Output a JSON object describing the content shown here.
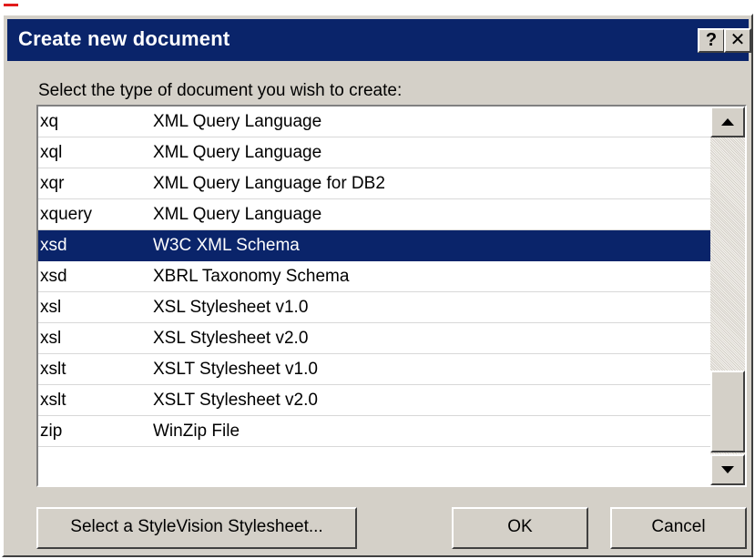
{
  "window": {
    "title": "Create new document",
    "help_label": "?",
    "close_label": "✕"
  },
  "prompt": "Select the type of document you wish to create:",
  "document_types": [
    {
      "ext": "xq",
      "description": "XML Query Language",
      "selected": false
    },
    {
      "ext": "xql",
      "description": "XML Query Language",
      "selected": false
    },
    {
      "ext": "xqr",
      "description": "XML Query Language for DB2",
      "selected": false
    },
    {
      "ext": "xquery",
      "description": "XML Query Language",
      "selected": false
    },
    {
      "ext": "xsd",
      "description": "W3C XML Schema",
      "selected": true
    },
    {
      "ext": "xsd",
      "description": "XBRL Taxonomy Schema",
      "selected": false
    },
    {
      "ext": "xsl",
      "description": "XSL Stylesheet v1.0",
      "selected": false
    },
    {
      "ext": "xsl",
      "description": "XSL Stylesheet v2.0",
      "selected": false
    },
    {
      "ext": "xslt",
      "description": "XSLT Stylesheet v1.0",
      "selected": false
    },
    {
      "ext": "xslt",
      "description": "XSLT Stylesheet v2.0",
      "selected": false
    },
    {
      "ext": "zip",
      "description": "WinZip File",
      "selected": false
    }
  ],
  "buttons": {
    "stylesheet": "Select a StyleVision Stylesheet...",
    "ok": "OK",
    "cancel": "Cancel"
  },
  "colors": {
    "titlebar": "#0a246a",
    "selection": "#0a246a",
    "dialog_face": "#d4d0c8"
  }
}
